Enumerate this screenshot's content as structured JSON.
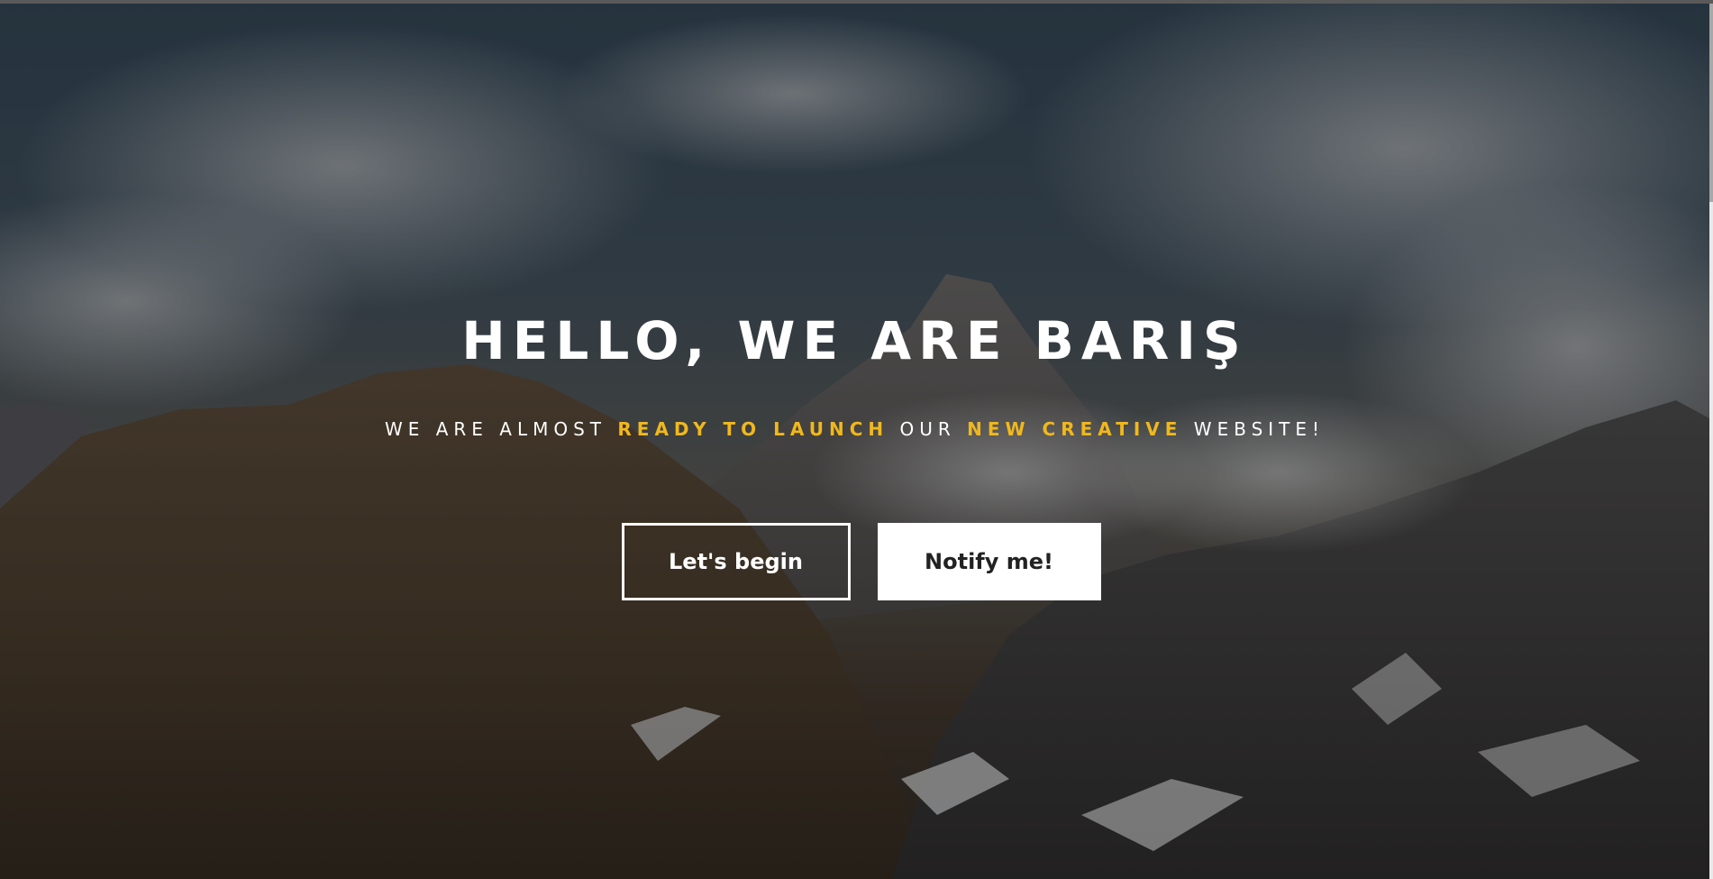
{
  "hero": {
    "title": "HELLO, WE ARE BARIŞ",
    "subtitle": {
      "part1": "WE ARE ALMOST ",
      "highlight1": "READY TO LAUNCH",
      "part2": " OUR ",
      "highlight2": "NEW CREATIVE",
      "part3": " WEBSITE!"
    },
    "buttons": {
      "primary": "Let's begin",
      "secondary": "Notify me!"
    }
  },
  "colors": {
    "accent": "#f0b81e",
    "text": "#ffffff",
    "button_solid_bg": "#ffffff",
    "button_solid_text": "#222222"
  },
  "background": {
    "image_subject": "cloudy mountain peaks with snow and rocky slopes"
  }
}
